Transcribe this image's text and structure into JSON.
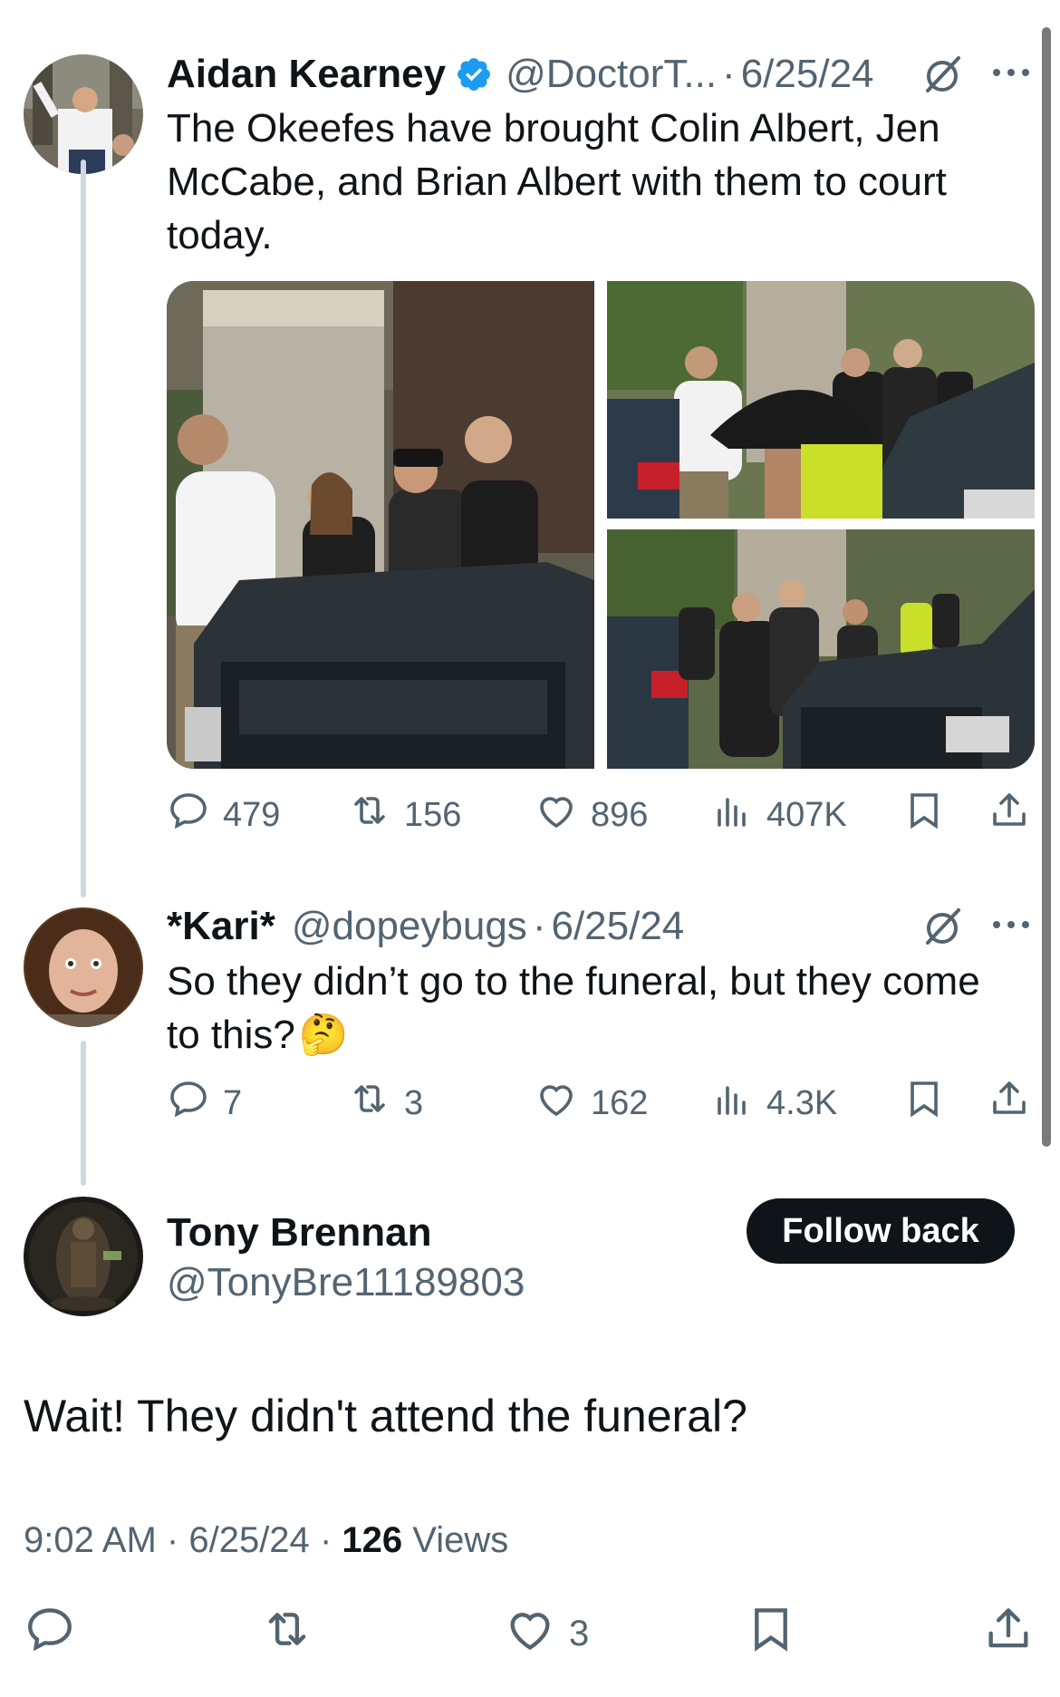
{
  "tweet1": {
    "author_name": "Aidan Kearney",
    "handle": "@DoctorT...",
    "date": "6/25/24",
    "text": "The Okeefes have brought Colin Albert, Jen McCabe, and Brian Albert with them to court today.",
    "replies": "479",
    "reposts": "156",
    "likes": "896",
    "views": "407K"
  },
  "tweet2": {
    "author_name": "*Kari*",
    "handle": "@dopeybugs",
    "date": "6/25/24",
    "text": "So they didn’t go to the funeral, but they come to this?",
    "emoji": "🤔",
    "replies": "7",
    "reposts": "3",
    "likes": "162",
    "views": "4.3K"
  },
  "main_tweet": {
    "author_name": "Tony Brennan",
    "handle": "@TonyBre11189803",
    "follow_label": "Follow back",
    "text": "Wait! They didn't attend the funeral?",
    "time": "9:02 AM",
    "date": "6/25/24",
    "views_count": "126",
    "views_label": "Views",
    "likes": "3"
  },
  "separator": "·",
  "icons": [
    "verified-badge-icon",
    "grok-icon",
    "more-icon",
    "reply-icon",
    "repost-icon",
    "like-icon",
    "views-icon",
    "bookmark-icon",
    "share-icon"
  ],
  "colors": {
    "text": "#0f1419",
    "secondary": "#536471",
    "verified": "#1d9bf0",
    "thread_line": "#cfd9de",
    "button_bg": "#0f1419"
  }
}
